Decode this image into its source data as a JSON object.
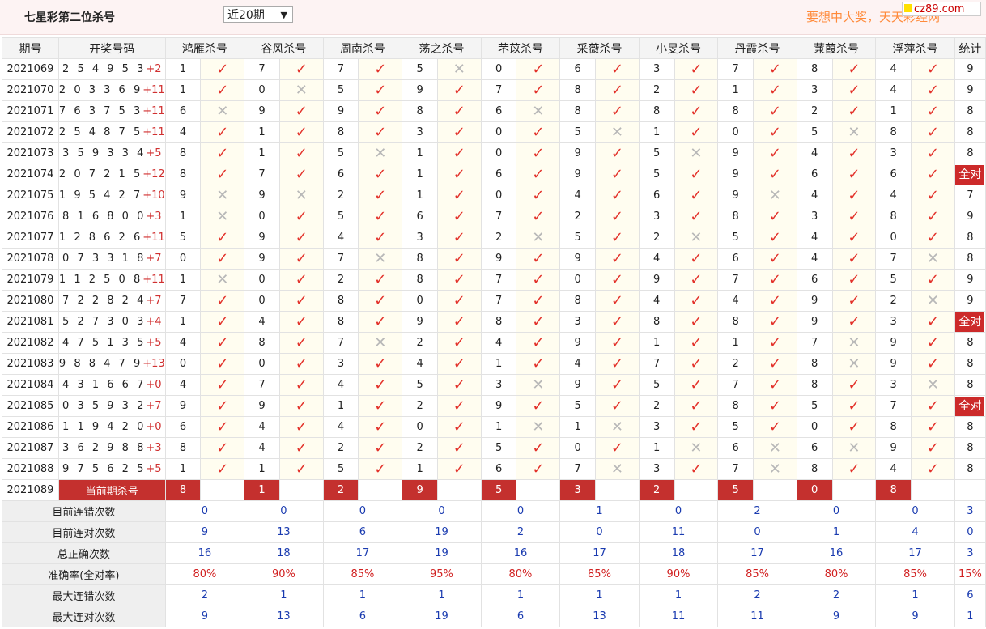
{
  "header": {
    "title": "七星彩第二位杀号",
    "period": "近20期",
    "promo": "要想中大奖，天天彩经网",
    "logo": "cz89.com"
  },
  "columns": {
    "issue": "期号",
    "draw": "开奖号码",
    "experts": [
      "鸿雁杀号",
      "谷风杀号",
      "周南杀号",
      "荡之杀号",
      "芣苡杀号",
      "采薇杀号",
      "小旻杀号",
      "丹霞杀号",
      "蒹葭杀号",
      "浮萍杀号"
    ],
    "stat": "统计"
  },
  "rows": [
    {
      "issue": "2021069",
      "nums": "2 5 4 9 5 3",
      "sum": "+2",
      "kills": [
        "1",
        "7",
        "7",
        "5",
        "0",
        "6",
        "3",
        "7",
        "8",
        "4"
      ],
      "marks": [
        1,
        1,
        1,
        0,
        1,
        1,
        1,
        1,
        1,
        1
      ],
      "stat": "9"
    },
    {
      "issue": "2021070",
      "nums": "2 0 3 3 6 9",
      "sum": "+11",
      "kills": [
        "1",
        "0",
        "5",
        "9",
        "7",
        "8",
        "2",
        "1",
        "3",
        "4"
      ],
      "marks": [
        1,
        0,
        1,
        1,
        1,
        1,
        1,
        1,
        1,
        1
      ],
      "stat": "9"
    },
    {
      "issue": "2021071",
      "nums": "7 6 3 7 5 3",
      "sum": "+11",
      "kills": [
        "6",
        "9",
        "9",
        "8",
        "6",
        "8",
        "8",
        "8",
        "2",
        "1"
      ],
      "marks": [
        0,
        1,
        1,
        1,
        0,
        1,
        1,
        1,
        1,
        1
      ],
      "stat": "8"
    },
    {
      "issue": "2021072",
      "nums": "2 5 4 8 7 5",
      "sum": "+11",
      "kills": [
        "4",
        "1",
        "8",
        "3",
        "0",
        "5",
        "1",
        "0",
        "5",
        "8"
      ],
      "marks": [
        1,
        1,
        1,
        1,
        1,
        0,
        1,
        1,
        0,
        1
      ],
      "stat": "8"
    },
    {
      "issue": "2021073",
      "nums": "3 5 9 3 3 4",
      "sum": "+5",
      "kills": [
        "8",
        "1",
        "5",
        "1",
        "0",
        "9",
        "5",
        "9",
        "4",
        "3"
      ],
      "marks": [
        1,
        1,
        0,
        1,
        1,
        1,
        0,
        1,
        1,
        1
      ],
      "stat": "8"
    },
    {
      "issue": "2021074",
      "nums": "2 0 7 2 1 5",
      "sum": "+12",
      "kills": [
        "8",
        "7",
        "6",
        "1",
        "6",
        "9",
        "5",
        "9",
        "6",
        "6"
      ],
      "marks": [
        1,
        1,
        1,
        1,
        1,
        1,
        1,
        1,
        1,
        1
      ],
      "stat": "全对"
    },
    {
      "issue": "2021075",
      "nums": "1 9 5 4 2 7",
      "sum": "+10",
      "kills": [
        "9",
        "9",
        "2",
        "1",
        "0",
        "4",
        "6",
        "9",
        "4",
        "4"
      ],
      "marks": [
        0,
        0,
        1,
        1,
        1,
        1,
        1,
        0,
        1,
        1
      ],
      "stat": "7"
    },
    {
      "issue": "2021076",
      "nums": "8 1 6 8 0 0",
      "sum": "+3",
      "kills": [
        "1",
        "0",
        "5",
        "6",
        "7",
        "2",
        "3",
        "8",
        "3",
        "8"
      ],
      "marks": [
        0,
        1,
        1,
        1,
        1,
        1,
        1,
        1,
        1,
        1
      ],
      "stat": "9"
    },
    {
      "issue": "2021077",
      "nums": "1 2 8 6 2 6",
      "sum": "+11",
      "kills": [
        "5",
        "9",
        "4",
        "3",
        "2",
        "5",
        "2",
        "5",
        "4",
        "0"
      ],
      "marks": [
        1,
        1,
        1,
        1,
        0,
        1,
        0,
        1,
        1,
        1
      ],
      "stat": "8"
    },
    {
      "issue": "2021078",
      "nums": "0 7 3 3 1 8",
      "sum": "+7",
      "kills": [
        "0",
        "9",
        "7",
        "8",
        "9",
        "9",
        "4",
        "6",
        "4",
        "7"
      ],
      "marks": [
        1,
        1,
        0,
        1,
        1,
        1,
        1,
        1,
        1,
        0
      ],
      "stat": "8"
    },
    {
      "issue": "2021079",
      "nums": "1 1 2 5 0 8",
      "sum": "+11",
      "kills": [
        "1",
        "0",
        "2",
        "8",
        "7",
        "0",
        "9",
        "7",
        "6",
        "5"
      ],
      "marks": [
        0,
        1,
        1,
        1,
        1,
        1,
        1,
        1,
        1,
        1
      ],
      "stat": "9"
    },
    {
      "issue": "2021080",
      "nums": "7 2 2 8 2 4",
      "sum": "+7",
      "kills": [
        "7",
        "0",
        "8",
        "0",
        "7",
        "8",
        "4",
        "4",
        "9",
        "2"
      ],
      "marks": [
        1,
        1,
        1,
        1,
        1,
        1,
        1,
        1,
        1,
        0
      ],
      "stat": "9"
    },
    {
      "issue": "2021081",
      "nums": "5 2 7 3 0 3",
      "sum": "+4",
      "kills": [
        "1",
        "4",
        "8",
        "9",
        "8",
        "3",
        "8",
        "8",
        "9",
        "3"
      ],
      "marks": [
        1,
        1,
        1,
        1,
        1,
        1,
        1,
        1,
        1,
        1
      ],
      "stat": "全对"
    },
    {
      "issue": "2021082",
      "nums": "4 7 5 1 3 5",
      "sum": "+5",
      "kills": [
        "4",
        "8",
        "7",
        "2",
        "4",
        "9",
        "1",
        "1",
        "7",
        "9"
      ],
      "marks": [
        1,
        1,
        0,
        1,
        1,
        1,
        1,
        1,
        0,
        1
      ],
      "stat": "8"
    },
    {
      "issue": "2021083",
      "nums": "9 8 8 4 7 9",
      "sum": "+13",
      "kills": [
        "0",
        "0",
        "3",
        "4",
        "1",
        "4",
        "7",
        "2",
        "8",
        "9"
      ],
      "marks": [
        1,
        1,
        1,
        1,
        1,
        1,
        1,
        1,
        0,
        1
      ],
      "stat": "8"
    },
    {
      "issue": "2021084",
      "nums": "4 3 1 6 6 7",
      "sum": "+0",
      "kills": [
        "4",
        "7",
        "4",
        "5",
        "3",
        "9",
        "5",
        "7",
        "8",
        "3"
      ],
      "marks": [
        1,
        1,
        1,
        1,
        0,
        1,
        1,
        1,
        1,
        0
      ],
      "stat": "8"
    },
    {
      "issue": "2021085",
      "nums": "0 3 5 9 3 2",
      "sum": "+7",
      "kills": [
        "9",
        "9",
        "1",
        "2",
        "9",
        "5",
        "2",
        "8",
        "5",
        "7"
      ],
      "marks": [
        1,
        1,
        1,
        1,
        1,
        1,
        1,
        1,
        1,
        1
      ],
      "stat": "全对"
    },
    {
      "issue": "2021086",
      "nums": "1 1 9 4 2 0",
      "sum": "+0",
      "kills": [
        "6",
        "4",
        "4",
        "0",
        "1",
        "1",
        "3",
        "5",
        "0",
        "8"
      ],
      "marks": [
        1,
        1,
        1,
        1,
        0,
        0,
        1,
        1,
        1,
        1
      ],
      "stat": "8"
    },
    {
      "issue": "2021087",
      "nums": "3 6 2 9 8 8",
      "sum": "+3",
      "kills": [
        "8",
        "4",
        "2",
        "2",
        "5",
        "0",
        "1",
        "6",
        "6",
        "9"
      ],
      "marks": [
        1,
        1,
        1,
        1,
        1,
        1,
        0,
        0,
        0,
        1
      ],
      "stat": "8"
    },
    {
      "issue": "2021088",
      "nums": "9 7 5 6 2 5",
      "sum": "+5",
      "kills": [
        "1",
        "1",
        "5",
        "1",
        "6",
        "7",
        "3",
        "7",
        "8",
        "4"
      ],
      "marks": [
        1,
        1,
        1,
        1,
        1,
        0,
        1,
        0,
        1,
        1
      ],
      "stat": "8"
    }
  ],
  "current": {
    "issue": "2021089",
    "label": "当前期杀号",
    "kills": [
      "8",
      "1",
      "2",
      "9",
      "5",
      "3",
      "2",
      "5",
      "0",
      "8"
    ]
  },
  "summary": [
    {
      "label": "目前连错次数",
      "values": [
        "0",
        "0",
        "0",
        "0",
        "0",
        "1",
        "0",
        "2",
        "0",
        "0"
      ],
      "stat": "3",
      "red": false
    },
    {
      "label": "目前连对次数",
      "values": [
        "9",
        "13",
        "6",
        "19",
        "2",
        "0",
        "11",
        "0",
        "1",
        "4"
      ],
      "stat": "0",
      "red": false
    },
    {
      "label": "总正确次数",
      "values": [
        "16",
        "18",
        "17",
        "19",
        "16",
        "17",
        "18",
        "17",
        "16",
        "17"
      ],
      "stat": "3",
      "red": false
    },
    {
      "label": "准确率(全对率)",
      "values": [
        "80%",
        "90%",
        "85%",
        "95%",
        "80%",
        "85%",
        "90%",
        "85%",
        "80%",
        "85%"
      ],
      "stat": "15%",
      "red": true
    },
    {
      "label": "最大连错次数",
      "values": [
        "2",
        "1",
        "1",
        "1",
        "1",
        "1",
        "1",
        "2",
        "2",
        "1"
      ],
      "stat": "6",
      "red": false
    },
    {
      "label": "最大连对次数",
      "values": [
        "9",
        "13",
        "6",
        "19",
        "6",
        "13",
        "11",
        "11",
        "9",
        "9"
      ],
      "stat": "1",
      "red": false
    }
  ],
  "icons": {
    "correct": "check-icon",
    "wrong": "cross-icon"
  },
  "colors": {
    "accent": "#c4302e",
    "tick": "#e3322b",
    "cross": "#b8b8b8",
    "summary_blue": "#1a3bb0",
    "summary_red": "#d12020",
    "promo": "#ff8a3a"
  }
}
